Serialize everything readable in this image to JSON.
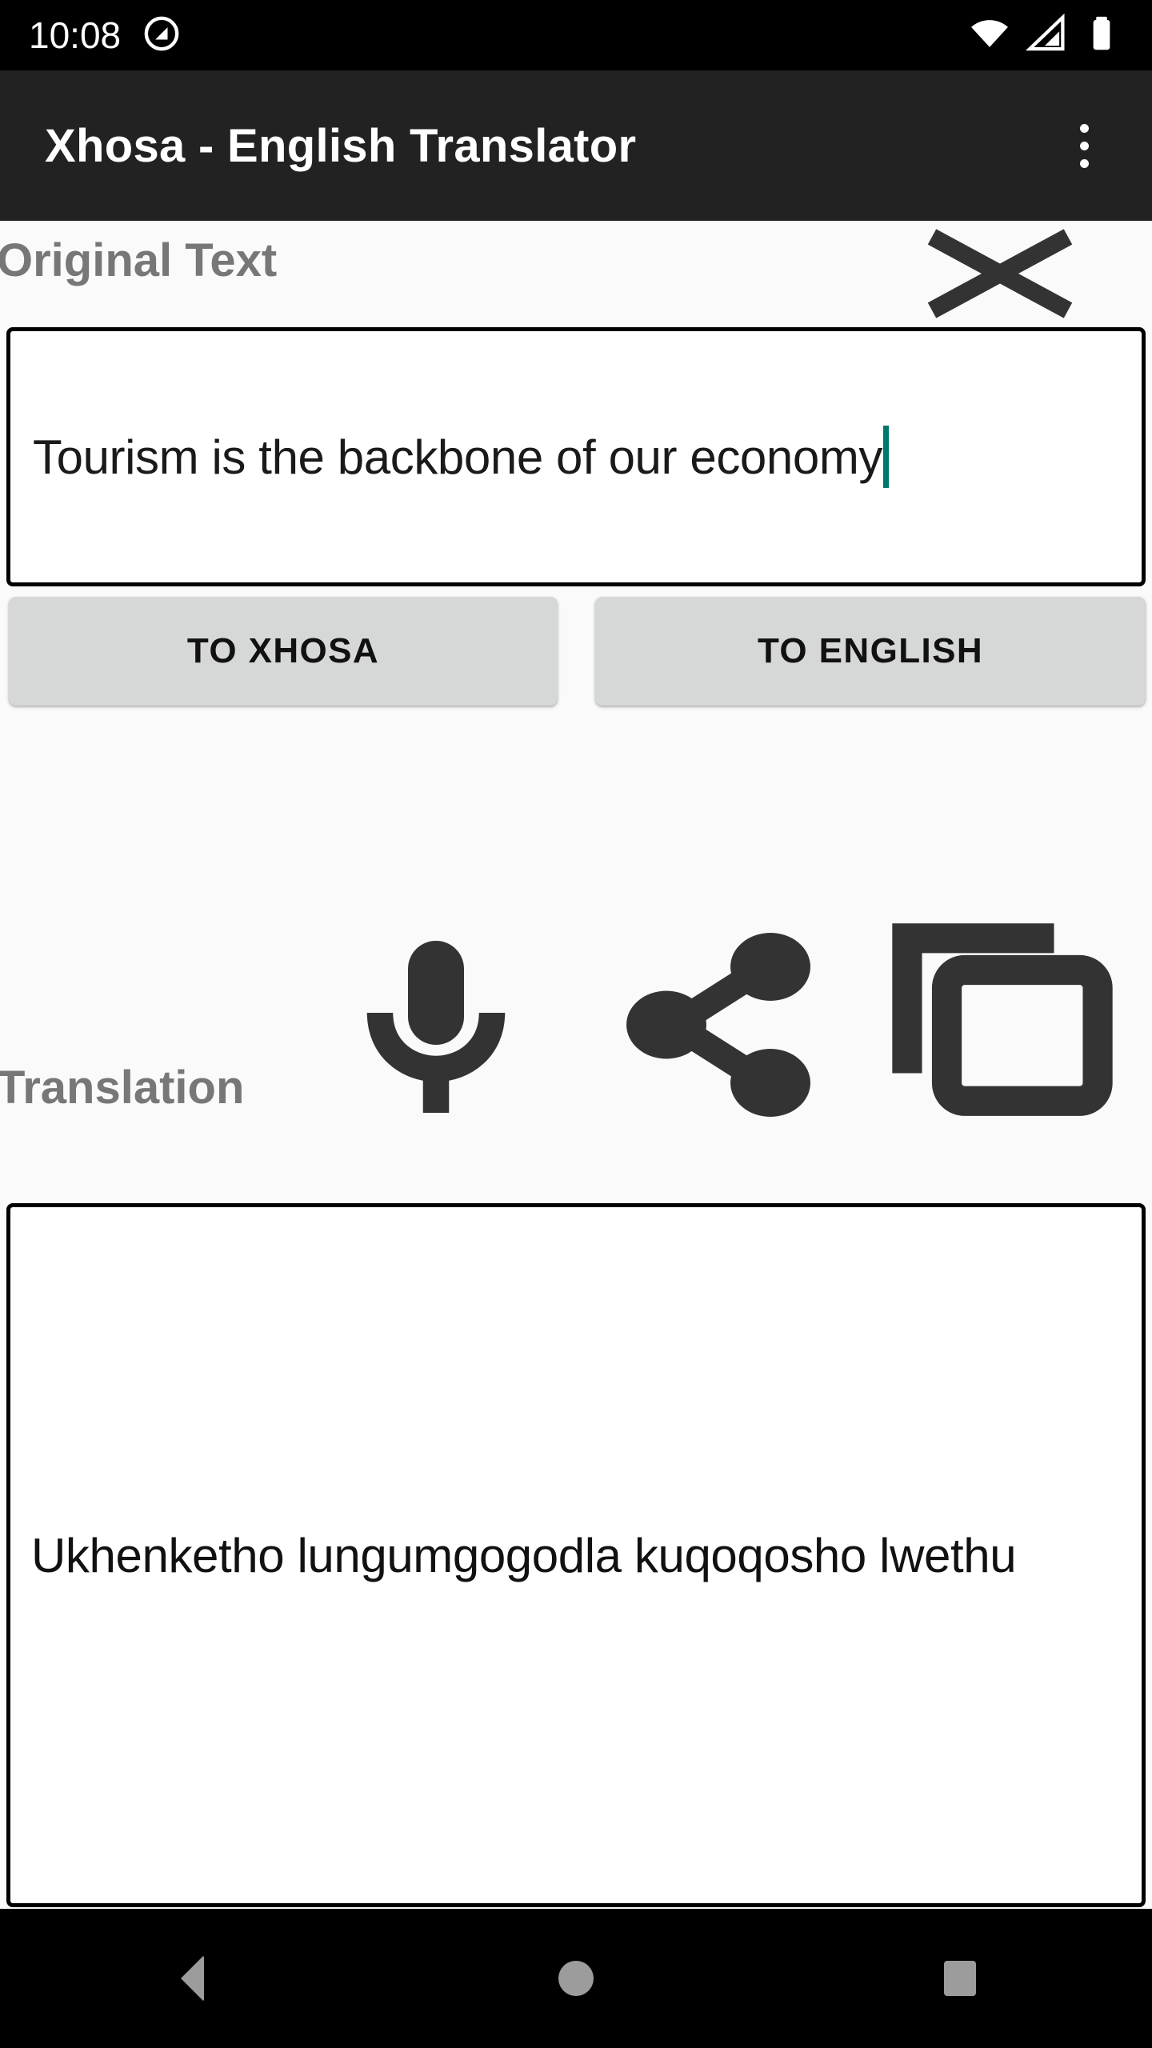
{
  "status_bar": {
    "time": "10:08",
    "icons": [
      "do-not-disturb-icon",
      "wifi-icon",
      "cellular-signal-icon",
      "battery-icon"
    ]
  },
  "app_bar": {
    "title": "Xhosa - English Translator",
    "overflow_menu_name": "more-options-icon"
  },
  "original_section": {
    "label": "Original Text",
    "clear_icon": "close-icon",
    "input": {
      "value": "Tourism is the backbone of our economy",
      "placeholder": "",
      "caret_color": "#00796B"
    }
  },
  "buttons": {
    "to_xhosa": "TO XHOSA",
    "to_english": "TO ENGLISH"
  },
  "translation_section": {
    "label": "Translation",
    "speak_icon": "microphone-icon",
    "share_icon": "share-icon",
    "copy_icon": "copy-icon",
    "output": {
      "value": "Ukhenketho lungumgogodla kuqoqosho lwethu"
    }
  },
  "nav_bar": {
    "back": "back-nav-icon",
    "home": "home-nav-icon",
    "recents": "recents-nav-icon"
  },
  "colors": {
    "app_bar_bg": "#222222",
    "page_bg": "#FAFAFA",
    "button_bg": "#D6D7D7",
    "label_gray": "#777777",
    "caret_teal": "#00796B",
    "icon_dark": "#333333"
  }
}
